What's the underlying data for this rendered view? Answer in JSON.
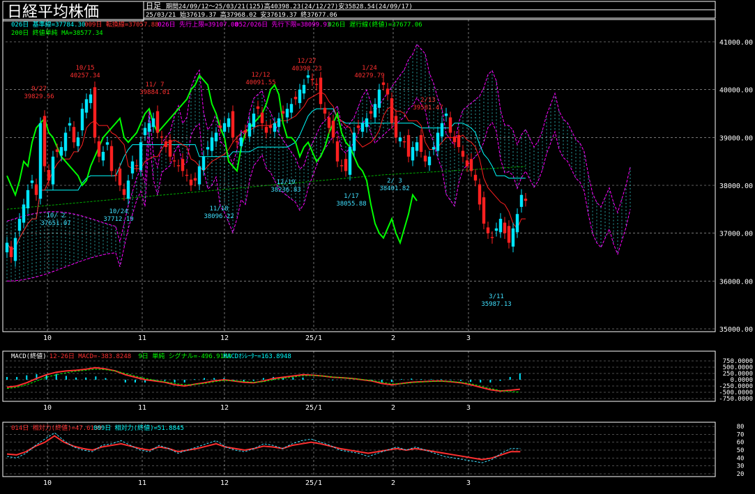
{
  "title": "日経平均株価",
  "period_type": "日足",
  "header_line1": "期間24/09/12～25/03/21(125)高40398.23(24/12/27)安35828.54(24/09/17)",
  "header_line2": "25/03/21",
  "header_line2b": "始37619.37 高37968.02 安37619.37 終37677.06",
  "legend_row1": [
    {
      "text": "026日 基準線=37784.30",
      "color": "#00ffff"
    },
    {
      "text": "009日 転換線=37057.88",
      "color": "#ff3030"
    },
    {
      "text": "026日 先行上限=39107.08",
      "color": "#ff00ff"
    },
    {
      "text": "052/026日 先行下限=38099.93",
      "color": "#ff00ff"
    },
    {
      "text": "026日 遅行線(終値)=37677.06",
      "color": "#00ff00"
    }
  ],
  "legend_row2": [
    {
      "text": "200日 終値単純 MA=38577.34",
      "color": "#00ff00"
    }
  ],
  "macd_legend": [
    {
      "text": "MACD(終値)",
      "color": "#ffffff"
    },
    {
      "text": "12-26日 MACD=-383.8248",
      "color": "#ff3030"
    },
    {
      "text": "9日 単純 シグナル=-496.9193",
      "color": "#00ff00"
    },
    {
      "text": "MACDｵｼﾚｰﾀｰ=163.8948",
      "color": "#00ffff"
    }
  ],
  "rsi_legend": [
    {
      "text": "014日 相対力(終値)=47.6139",
      "color": "#ff3030"
    },
    {
      "text": "009日 相対力(終値)=51.8845",
      "color": "#00ffff"
    }
  ],
  "colors": {
    "up": "#00e5ff",
    "down": "#ff2020",
    "kijun": "#00ffff",
    "tenkan": "#ff2020",
    "senkou": "#ff00ff",
    "chikou": "#00ff00",
    "ma200": "#00b000",
    "grid": "#ffffff"
  },
  "chart_data": [
    {
      "type": "candlestick",
      "title": "日経平均株価",
      "yaxis_ticks": [
        "41000.00",
        "40000.00",
        "39000.00",
        "38000.00",
        "37000.00",
        "36000.00",
        "35000.00"
      ],
      "ylim": [
        35000,
        41000
      ],
      "xaxis_ticks": [
        "10",
        "11",
        "12",
        "25/1",
        "2",
        "3"
      ],
      "annotations": [
        {
          "date": "9/27",
          "value": "39829.56",
          "kind": "high"
        },
        {
          "date": "10/15",
          "value": "40257.34",
          "kind": "high"
        },
        {
          "date": "11/ 7",
          "value": "39884.01",
          "kind": "high"
        },
        {
          "date": "12/12",
          "value": "40091.55",
          "kind": "high"
        },
        {
          "date": "12/27",
          "value": "40398.23",
          "kind": "high"
        },
        {
          "date": "1/24",
          "value": "40279.79",
          "kind": "high"
        },
        {
          "date": "2/13",
          "value": "39581.47",
          "kind": "high"
        },
        {
          "date": "10/ 2",
          "value": "37651.07",
          "kind": "low"
        },
        {
          "date": "10/24",
          "value": "37712.19",
          "kind": "low"
        },
        {
          "date": "11/18",
          "value": "38096.22",
          "kind": "low"
        },
        {
          "date": "12/19",
          "value": "38236.83",
          "kind": "low"
        },
        {
          "date": "1/17",
          "value": "38055.88",
          "kind": "low"
        },
        {
          "date": "2/ 3",
          "value": "38401.82",
          "kind": "low"
        },
        {
          "date": "3/11",
          "value": "35987.13",
          "kind": "low"
        }
      ],
      "close_series": [
        36800,
        36500,
        36900,
        37300,
        37600,
        37900,
        38100,
        37800,
        39300,
        38400,
        38100,
        38600,
        38700,
        38800,
        39100,
        39300,
        38900,
        39000,
        39600,
        39800,
        39900,
        39000,
        38600,
        38700,
        38900,
        38300,
        38200,
        38000,
        37800,
        38100,
        38500,
        38400,
        38900,
        39200,
        39300,
        39400,
        39100,
        39000,
        38800,
        38600,
        38500,
        38400,
        38300,
        38200,
        38000,
        38100,
        38400,
        38600,
        38800,
        39000,
        39100,
        39200,
        39300,
        39400,
        39000,
        38900,
        39000,
        39100,
        39300,
        39500,
        39600,
        39300,
        39100,
        39200,
        39300,
        39400,
        39500,
        39600,
        39700,
        39800,
        40000,
        40100,
        40300,
        40200,
        40100,
        39700,
        39500,
        39200,
        39000,
        38500,
        38400,
        38300,
        38800,
        39100,
        39200,
        39300,
        39400,
        39500,
        39700,
        40000,
        40100,
        39900,
        39300,
        39000,
        39000,
        38900,
        38600,
        38800,
        38900,
        38700,
        38500,
        38600,
        38800,
        39100,
        39300,
        39500,
        39100,
        38900,
        38800,
        38600,
        38400,
        38300,
        38100,
        37600,
        37200,
        37000,
        36900,
        37100,
        37300,
        37000,
        36800,
        37100,
        37400,
        37800,
        37677
      ]
    },
    {
      "type": "line",
      "title": "MACD(終値)",
      "yaxis_ticks": [
        "750.0000",
        "500.0000",
        "250.0000",
        "0.0000",
        "-250.0000",
        "-500.0000",
        "-750.0000"
      ],
      "ylim": [
        -750,
        750
      ],
      "xaxis_ticks": [
        "10",
        "11",
        "12",
        "25/1",
        "2",
        "3"
      ],
      "series": [
        {
          "name": "12-26日 MACD",
          "values": [
            -300,
            -250,
            -120,
            50,
            200,
            300,
            350,
            380,
            420,
            480,
            430,
            350,
            200,
            100,
            0,
            -50,
            -100,
            -200,
            -250,
            -180,
            -120,
            -50,
            0,
            -50,
            -100,
            -120,
            -50,
            50,
            100,
            150,
            200,
            180,
            150,
            100,
            80,
            50,
            0,
            -50,
            -150,
            -200,
            -150,
            -100,
            -80,
            -60,
            -50,
            -80,
            -120,
            -200,
            -300,
            -400,
            -450,
            -420,
            -380
          ]
        },
        {
          "name": "9日 単純 シグナル",
          "values": [
            -350,
            -300,
            -200,
            -50,
            100,
            200,
            280,
            340,
            380,
            420,
            400,
            350,
            250,
            150,
            50,
            -20,
            -80,
            -150,
            -200,
            -190,
            -150,
            -80,
            -30,
            -40,
            -70,
            -100,
            -80,
            0,
            60,
            110,
            160,
            170,
            150,
            110,
            80,
            50,
            10,
            -30,
            -100,
            -160,
            -160,
            -120,
            -90,
            -70,
            -60,
            -70,
            -100,
            -160,
            -250,
            -350,
            -430,
            -470,
            -497
          ]
        }
      ]
    },
    {
      "type": "line",
      "title": "相対力",
      "yaxis_ticks": [
        "80",
        "70",
        "60",
        "50",
        "40",
        "30",
        "20"
      ],
      "ylim": [
        20,
        80
      ],
      "xaxis_ticks": [
        "10",
        "11",
        "12",
        "25/1",
        "2",
        "3"
      ],
      "series": [
        {
          "name": "014日 相対力(終値)",
          "values": [
            45,
            44,
            48,
            55,
            60,
            68,
            60,
            55,
            52,
            50,
            54,
            56,
            58,
            55,
            52,
            50,
            54,
            52,
            48,
            50,
            52,
            55,
            58,
            54,
            52,
            50,
            52,
            55,
            54,
            52,
            56,
            58,
            60,
            58,
            55,
            52,
            50,
            48,
            46,
            48,
            50,
            52,
            50,
            52,
            50,
            48,
            46,
            44,
            42,
            40,
            38,
            40,
            44,
            48,
            48
          ]
        },
        {
          "name": "009日 相対力(終値)",
          "values": [
            42,
            40,
            46,
            56,
            64,
            72,
            62,
            54,
            50,
            48,
            56,
            58,
            62,
            56,
            50,
            48,
            56,
            52,
            46,
            50,
            54,
            58,
            62,
            54,
            50,
            48,
            52,
            58,
            56,
            52,
            58,
            62,
            64,
            60,
            56,
            50,
            48,
            46,
            42,
            46,
            50,
            54,
            50,
            54,
            50,
            46,
            42,
            40,
            38,
            36,
            34,
            38,
            46,
            52,
            52
          ]
        }
      ]
    }
  ]
}
